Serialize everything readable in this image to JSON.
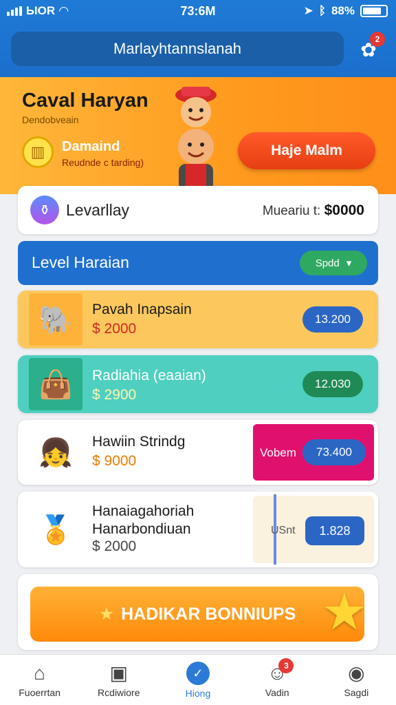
{
  "status_bar": {
    "carrier": "ЫOR",
    "time": "73:6M",
    "battery": "88%"
  },
  "header": {
    "search_text": "Marlayhtannslanah",
    "notification_count": "2"
  },
  "hero": {
    "title": "Caval Haryan",
    "subtitle": "Dendobveain",
    "coin_title": "Damaind",
    "coin_subtitle": "Reudnde c tarding)",
    "cta_label": "Haje Malm"
  },
  "level_card": {
    "label": "Levarllay",
    "target_label": "Mueariu t:",
    "target_value": "$0000"
  },
  "section": {
    "title": "Level Haraian",
    "filter_label": "Spdd"
  },
  "items": [
    {
      "name": "Pavah Inapsain",
      "price": "$ 2000",
      "pill": "13.200"
    },
    {
      "name": "Radiahia (eaaian)",
      "price": "$ 2900",
      "pill": "12.030"
    },
    {
      "name": "Hawiin Strindg",
      "price": "$ 9000",
      "tag": "Vobem",
      "pill": "73.400"
    },
    {
      "name": "Hanaiagahoriah Hanarbondiuan",
      "price": "$ 2000",
      "tag": "USnt",
      "pill": "1.828"
    }
  ],
  "bonus": {
    "label": "HADIKAR BONNIUPS"
  },
  "bottom_nav": [
    {
      "label": "Fuoerrtan",
      "icon": "home-icon"
    },
    {
      "label": "Rcdiwiore",
      "icon": "wallet-icon"
    },
    {
      "label": "Hiong",
      "icon": "check-icon",
      "active": true
    },
    {
      "label": "Vadin",
      "icon": "user-icon",
      "badge": "3"
    },
    {
      "label": "Sagdi",
      "icon": "profile-icon"
    }
  ],
  "colors": {
    "primary": "#1f6fcf",
    "accent": "#ff5a2a",
    "hero": "#ff9a1e"
  }
}
